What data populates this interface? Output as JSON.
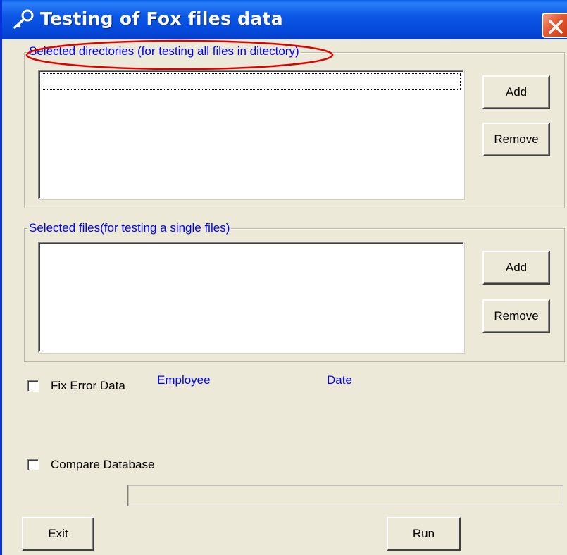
{
  "window": {
    "title": "Testing of Fox files data",
    "title_icon": "key-icon",
    "close_icon": "close-icon",
    "accent_color": "#0A5EEA",
    "close_color": "#E45A34"
  },
  "directories_group": {
    "legend": "Selected directories (for testing all files in ditectory)",
    "add_label": "Add",
    "remove_label": "Remove",
    "items": []
  },
  "files_group": {
    "legend": "Selected files(for testing a single files)",
    "add_label": "Add",
    "remove_label": "Remove",
    "items": []
  },
  "options": {
    "fix_error_label": "Fix Error Data",
    "fix_error_checked": false,
    "employee_label": "Employee",
    "date_label": "Date",
    "compare_db_label": "Compare Database",
    "compare_db_checked": false
  },
  "progress": {
    "value": 0
  },
  "footer": {
    "exit_label": "Exit",
    "run_label": "Run"
  },
  "annotation": {
    "color": "#E00000"
  }
}
